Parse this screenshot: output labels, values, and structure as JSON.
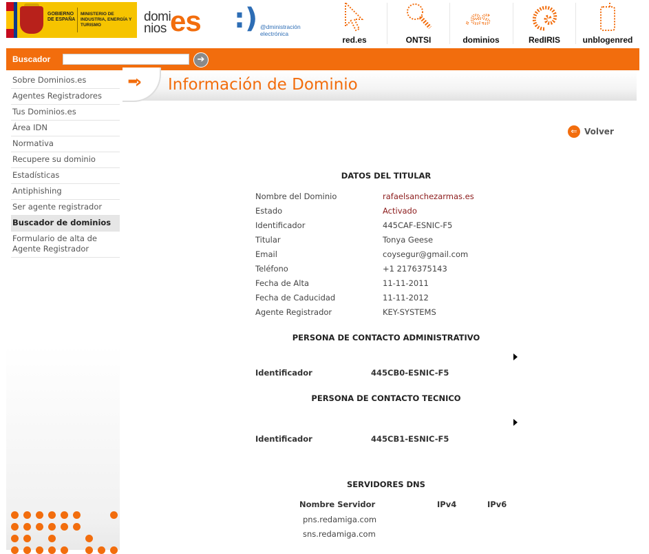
{
  "header": {
    "gob_logo": {
      "text_gobierno": "GOBIERNO DE ESPAÑA",
      "text_ministerio": "MINISTERIO DE INDUSTRIA, ENERGÍA Y TURISMO"
    },
    "dominios_logo": {
      "part1": "domi",
      "part2": "nios",
      "es": "es"
    },
    "admin_logo": {
      "smile": ":)",
      "text": "@dministración electrónica"
    },
    "links": [
      {
        "label": "red.es",
        "icon": "cursor-arrow-icon"
      },
      {
        "label": "ONTSI",
        "icon": "magnifier-icon"
      },
      {
        "label": "dominios",
        "icon": "dot-es-icon"
      },
      {
        "label": "RedIRIS",
        "icon": "spiral-icon"
      },
      {
        "label": "unblogenred",
        "icon": "phone-icon"
      }
    ],
    "accent_color": "#f26d0d"
  },
  "search": {
    "label": "Buscador",
    "value": "",
    "button_icon": "arrow-right-icon"
  },
  "sidebar": {
    "items": [
      {
        "label": "Sobre Dominios.es"
      },
      {
        "label": "Agentes Registradores"
      },
      {
        "label": "Tus Dominios.es"
      },
      {
        "label": "Área IDN"
      },
      {
        "label": "Normativa"
      },
      {
        "label": "Recupere su dominio"
      },
      {
        "label": "Estadísticas"
      },
      {
        "label": "Antiphishing"
      },
      {
        "label": "Ser agente registrador"
      },
      {
        "label": "Buscador de dominios",
        "active": true
      },
      {
        "label": "Formulario de alta de Agente Registrador"
      }
    ]
  },
  "main": {
    "title": "Información de Dominio",
    "back_label": "Volver",
    "titular": {
      "heading": "DATOS DEL TITULAR",
      "rows": [
        {
          "key": "Nombre del Dominio",
          "value": "rafaelsanchezarmas.es"
        },
        {
          "key": "Estado",
          "value": "Activado"
        },
        {
          "key": "Identificador",
          "value": "445CAF-ESNIC-F5"
        },
        {
          "key": "Titular",
          "value": "Tonya Geese"
        },
        {
          "key": "Email",
          "value": "coysegur@gmail.com"
        },
        {
          "key": "Teléfono",
          "value": "+1 2176375143"
        },
        {
          "key": "Fecha de Alta",
          "value": "11-11-2011"
        },
        {
          "key": "Fecha de Caducidad",
          "value": "11-11-2012"
        },
        {
          "key": "Agente Registrador",
          "value": "KEY-SYSTEMS"
        }
      ]
    },
    "admin_contact": {
      "heading": "PERSONA DE CONTACTO ADMINISTRATIVO",
      "id_label": "Identificador",
      "id_value": "445CB0-ESNIC-F5"
    },
    "tech_contact": {
      "heading": "PERSONA DE CONTACTO TECNICO",
      "id_label": "Identificador",
      "id_value": "445CB1-ESNIC-F5"
    },
    "dns": {
      "heading": "SERVIDORES DNS",
      "columns": [
        "Nombre Servidor",
        "IPv4",
        "IPv6"
      ],
      "servers": [
        "pns.redamiga.com",
        "sns.redamiga.com"
      ]
    }
  }
}
